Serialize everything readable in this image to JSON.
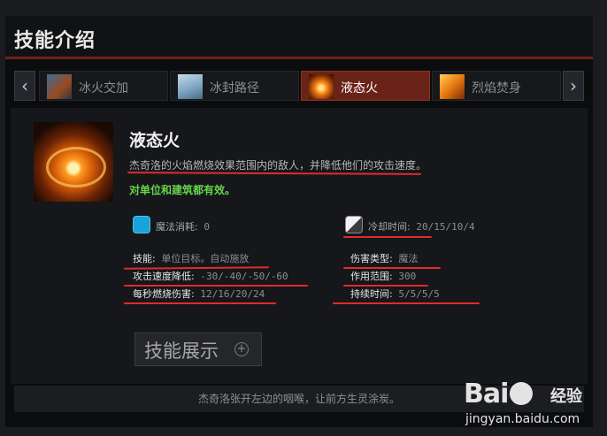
{
  "header": {
    "title": "技能介绍"
  },
  "tabs": [
    {
      "label": "冰火交加",
      "icon": "ice-fire-icon"
    },
    {
      "label": "冰封路径",
      "icon": "ice-path-icon"
    },
    {
      "label": "液态火",
      "icon": "liquid-fire-icon",
      "active": true
    },
    {
      "label": "烈焰焚身",
      "icon": "macropyre-icon"
    }
  ],
  "skill": {
    "name": "液态火",
    "description": "杰奇洛的火焰燃烧效果范围内的敌人，并降低他们的攻击速度。",
    "note": "对单位和建筑都有效。",
    "mana": {
      "label": "魔法消耗:",
      "value": "0"
    },
    "cooldown": {
      "label": "冷却时间:",
      "value": "20/15/10/4"
    },
    "ability": {
      "label": "技能:",
      "value": "单位目标。自动施放"
    },
    "damage_type": {
      "label": "伤害类型:",
      "value": "魔法"
    },
    "attack_slow": {
      "label": "攻击速度降低:",
      "value": "-30/-40/-50/-60"
    },
    "radius": {
      "label": "作用范围:",
      "value": "300"
    },
    "dps": {
      "label": "每秒燃烧伤害:",
      "value": "12/16/20/24"
    },
    "duration": {
      "label": "持续时间:",
      "value": "5/5/5/5"
    }
  },
  "showcase": {
    "label": "技能展示",
    "plus": "+"
  },
  "footer": {
    "quote": "杰奇洛张开左边的咽喉，让前方生灵涂炭。"
  },
  "watermark": {
    "logo": "Bai",
    "logo_sub": "经验",
    "url": "jingyan.baidu.com"
  },
  "colors": {
    "accent": "#6a2318",
    "note": "#67d44c",
    "annotation": "#e12b2b"
  }
}
